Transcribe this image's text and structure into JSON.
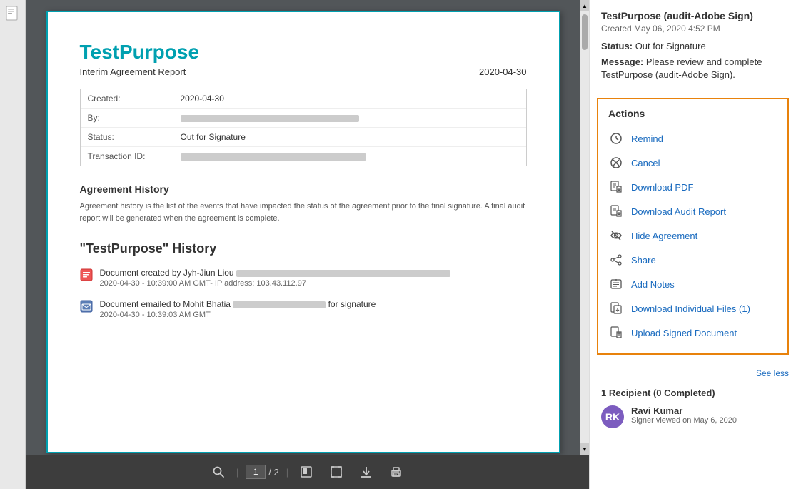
{
  "document": {
    "title": "TestPurpose",
    "subtitle": "Interim Agreement Report",
    "date": "2020-04-30",
    "info": {
      "created_label": "Created:",
      "created_value": "2020-04-30",
      "by_label": "By:",
      "status_label": "Status:",
      "status_value": "Out for Signature",
      "transaction_label": "Transaction ID:"
    },
    "agreement_history_title": "Agreement History",
    "agreement_history_desc": "Agreement history is the list of the events that have impacted the status of the agreement prior to the final signature. A final audit report will be generated when the agreement is complete.",
    "history_section_title": "\"TestPurpose\" History",
    "history_items": [
      {
        "text": "Document created by Jyh-Jiun Liou",
        "meta": "2020-04-30 - 10:39:00 AM GMT- IP address: 103.43.112.97",
        "type": "created"
      },
      {
        "text": "Document emailed to Mohit Bhatia                              for signature",
        "meta": "2020-04-30 - 10:39:03 AM GMT",
        "type": "emailed"
      }
    ]
  },
  "toolbar": {
    "page_current": "1",
    "page_total": "/ 2"
  },
  "right_panel": {
    "agreement_name": "TestPurpose (audit-Adobe Sign)",
    "created_date": "Created May 06, 2020 4:52 PM",
    "status_label": "Status:",
    "status_value": "Out for Signature",
    "message_label": "Message:",
    "message_value": "Please review and complete TestPurpose (audit-Adobe Sign).",
    "actions_title": "Actions",
    "actions": [
      {
        "label": "Remind",
        "icon": "⏰",
        "name": "remind"
      },
      {
        "label": "Cancel",
        "icon": "⊗",
        "name": "cancel"
      },
      {
        "label": "Download PDF",
        "icon": "📄",
        "name": "download-pdf"
      },
      {
        "label": "Download Audit Report",
        "icon": "📋",
        "name": "download-audit-report"
      },
      {
        "label": "Hide Agreement",
        "icon": "🙈",
        "name": "hide-agreement"
      },
      {
        "label": "Share",
        "icon": "🔗",
        "name": "share"
      },
      {
        "label": "Add Notes",
        "icon": "💬",
        "name": "add-notes"
      },
      {
        "label": "Download Individual Files (1)",
        "icon": "📁",
        "name": "download-individual-files"
      },
      {
        "label": "Upload Signed Document",
        "icon": "📤",
        "name": "upload-signed-document"
      }
    ],
    "see_less": "See less",
    "recipients_title": "1 Recipient (0 Completed)",
    "recipient": {
      "name": "Ravi Kumar",
      "status": "Signer viewed on May 6, 2020",
      "initials": "RK"
    }
  }
}
